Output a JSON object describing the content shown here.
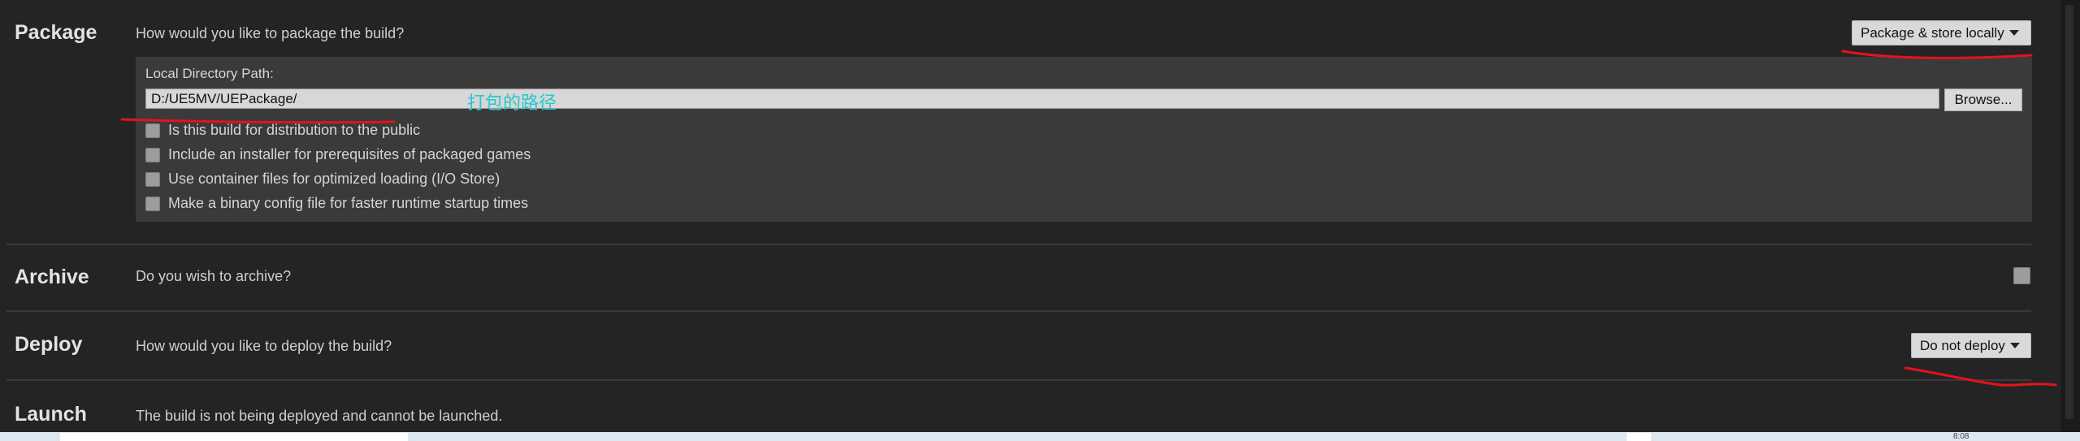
{
  "package": {
    "title": "Package",
    "prompt": "How would you like to package the build?",
    "combo_value": "Package & store locally",
    "path_label": "Local Directory Path:",
    "path_value": "D:/UE5MV/UEPackage/",
    "browse_label": "Browse...",
    "options": [
      "Is this build for distribution to the public",
      "Include an installer for prerequisites of packaged games",
      "Use container files for optimized loading (I/O Store)",
      "Make a binary config file for faster runtime startup times"
    ],
    "annotation": "打包的路径"
  },
  "archive": {
    "title": "Archive",
    "prompt": "Do you wish to archive?"
  },
  "deploy": {
    "title": "Deploy",
    "prompt": "How would you like to deploy the build?",
    "combo_value": "Do not deploy"
  },
  "launch": {
    "title": "Launch",
    "prompt": "The build is not being deployed and cannot be launched."
  },
  "taskbar": {
    "clock": "8:08"
  },
  "colors": {
    "background": "#242424",
    "panel": "#3a3a3a",
    "annotation_red": "#e3131b",
    "annotation_text": "#27c7d0"
  },
  "icons": [
    "dropdown-arrow-icon",
    "checkbox-icon"
  ]
}
